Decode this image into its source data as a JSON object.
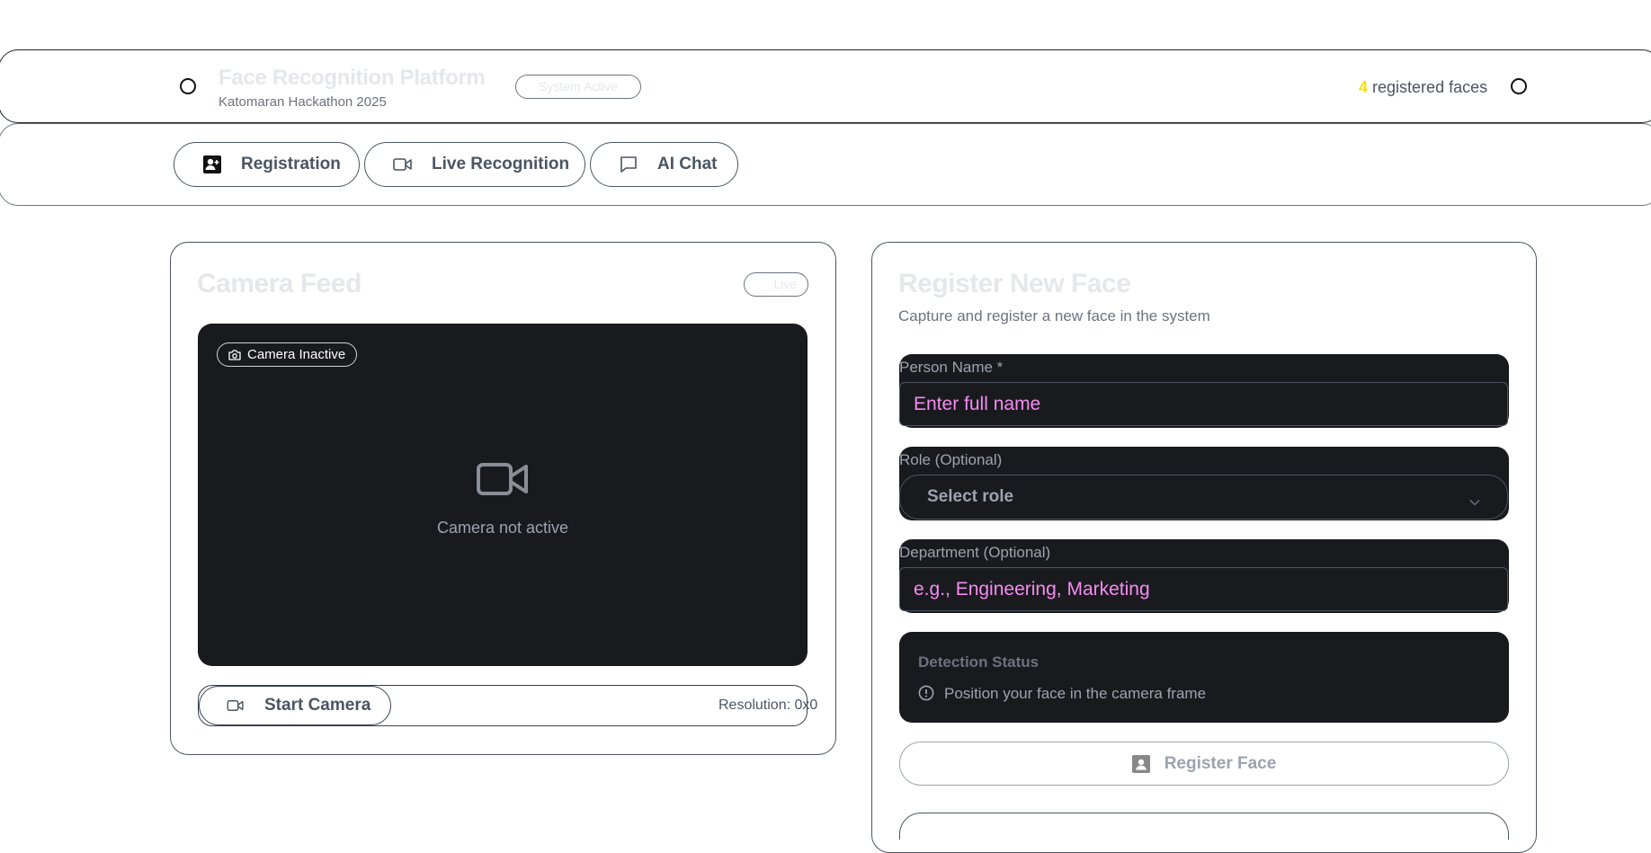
{
  "header": {
    "title": "Face Recognition Platform",
    "subtitle": "Katomaran Hackathon 2025",
    "status_badge": "System Active",
    "registered_count": "4",
    "registered_label": "registered faces"
  },
  "tabs": [
    {
      "label": "Registration",
      "icon": "user-plus-icon",
      "active": true
    },
    {
      "label": "Live Recognition",
      "icon": "video-icon",
      "active": false
    },
    {
      "label": "AI Chat",
      "icon": "chat-icon",
      "active": false
    }
  ],
  "camera_card": {
    "title": "Camera Feed",
    "live_badge": "Live",
    "status_badge": "Camera Inactive",
    "placeholder_text": "Camera not active",
    "start_button": "Start Camera",
    "resolution": "Resolution: 0x0"
  },
  "register_card": {
    "title": "Register New Face",
    "subtitle": "Capture and register a new face in the system",
    "name_label": "Person Name *",
    "name_placeholder": "Enter full name",
    "role_label": "Role (Optional)",
    "role_value": "Select role",
    "dept_label": "Department (Optional)",
    "dept_placeholder": "e.g., Engineering, Marketing",
    "detection_title": "Detection Status",
    "detection_text": "Position your face in the camera frame",
    "register_button": "Register Face"
  },
  "colors": {
    "dark_panel": "#191a1e",
    "placeholder_pink": "#f58bf2",
    "count_yellow": "#f5e10b"
  }
}
